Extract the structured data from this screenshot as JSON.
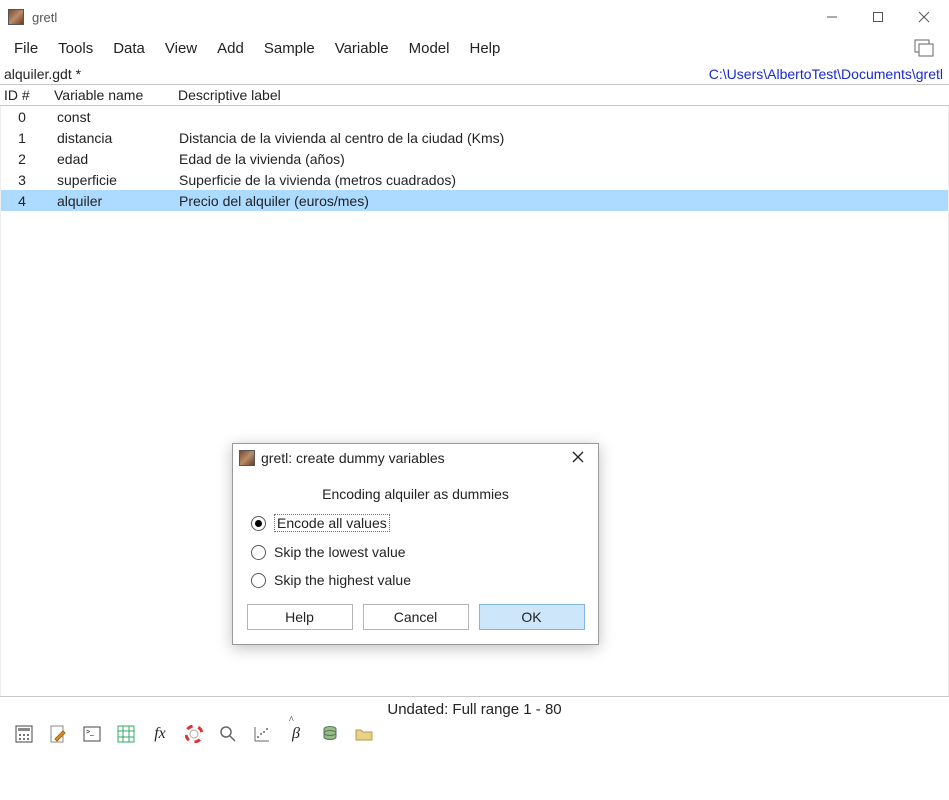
{
  "window": {
    "title": "gretl"
  },
  "menu": {
    "items": [
      "File",
      "Tools",
      "Data",
      "View",
      "Add",
      "Sample",
      "Variable",
      "Model",
      "Help"
    ]
  },
  "fileinfo": {
    "filename": "alquiler.gdt *",
    "filepath": "C:\\Users\\AlbertoTest\\Documents\\gretl"
  },
  "table": {
    "headers": {
      "id": "ID #",
      "name": "Variable name",
      "label": "Descriptive label"
    },
    "rows": [
      {
        "id": "0",
        "name": "const",
        "label": "",
        "selected": false
      },
      {
        "id": "1",
        "name": "distancia",
        "label": "Distancia de la vivienda al centro de la ciudad (Kms)",
        "selected": false
      },
      {
        "id": "2",
        "name": "edad",
        "label": "Edad de la vivienda (años)",
        "selected": false
      },
      {
        "id": "3",
        "name": "superficie",
        "label": "Superficie de la vivienda (metros cuadrados)",
        "selected": false
      },
      {
        "id": "4",
        "name": "alquiler",
        "label": "Precio del alquiler (euros/mes)",
        "selected": true
      }
    ]
  },
  "status": "Undated: Full range 1 - 80",
  "toolbar_icons": [
    "calculator-icon",
    "edit-icon",
    "terminal-icon",
    "grid-icon",
    "fx-icon",
    "lifebuoy-icon",
    "magnify-icon",
    "scatter-icon",
    "beta-icon",
    "database-icon",
    "folder-icon"
  ],
  "dialog": {
    "title": "gretl: create dummy variables",
    "subtitle": "Encoding alquiler as dummies",
    "options": [
      {
        "label": "Encode all values",
        "checked": true
      },
      {
        "label": "Skip the lowest value",
        "checked": false
      },
      {
        "label": "Skip the highest value",
        "checked": false
      }
    ],
    "buttons": {
      "help": "Help",
      "cancel": "Cancel",
      "ok": "OK"
    }
  }
}
